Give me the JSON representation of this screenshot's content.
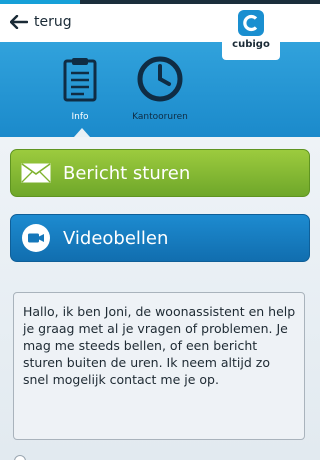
{
  "header": {
    "back_label": "terug",
    "logo_text": "cubigo"
  },
  "tabs": [
    {
      "label": "Info",
      "icon": "clipboard-icon",
      "selected": true
    },
    {
      "label": "Kantooruren",
      "icon": "clock-icon",
      "selected": false
    }
  ],
  "actions": {
    "message_label": "Bericht sturen",
    "video_label": "Videobellen"
  },
  "info": {
    "text": "Hallo, ik ben Joni, de woonassistent en help je graag met al je vragen of problemen. Je mag me steeds bellen, of een bericht sturen buiten de uren. Ik neem altijd zo snel mogelijk contact me je op."
  },
  "colors": {
    "accent_blue": "#1b8acb",
    "message_green": "#8bbd35",
    "video_blue": "#1780c2"
  }
}
